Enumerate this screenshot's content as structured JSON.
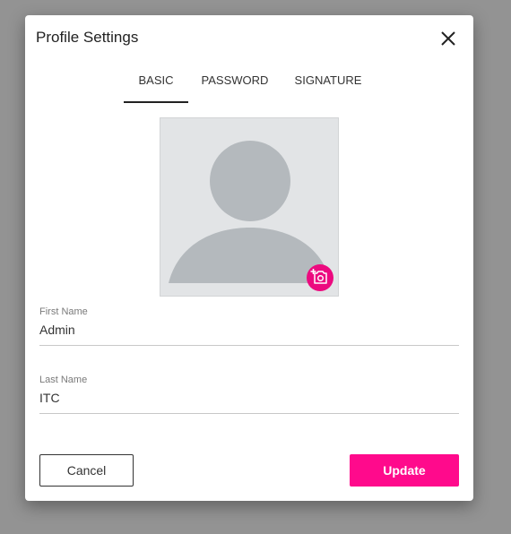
{
  "dialog": {
    "title": "Profile Settings",
    "close_icon": "close-icon"
  },
  "tabs": [
    {
      "label": "BASIC",
      "active": true
    },
    {
      "label": "PASSWORD",
      "active": false
    },
    {
      "label": "SIGNATURE",
      "active": false
    }
  ],
  "avatar": {
    "placeholder_icon": "user-silhouette-icon",
    "camera_icon": "add-photo-icon"
  },
  "form": {
    "first_name": {
      "label": "First Name",
      "value": "Admin"
    },
    "last_name": {
      "label": "Last Name",
      "value": "ITC"
    }
  },
  "actions": {
    "cancel_label": "Cancel",
    "update_label": "Update"
  },
  "colors": {
    "accent": "#ff0a8c",
    "overlay": "#939393",
    "avatar_bg": "#e2e4e6",
    "avatar_shape": "#b4b9bd"
  }
}
